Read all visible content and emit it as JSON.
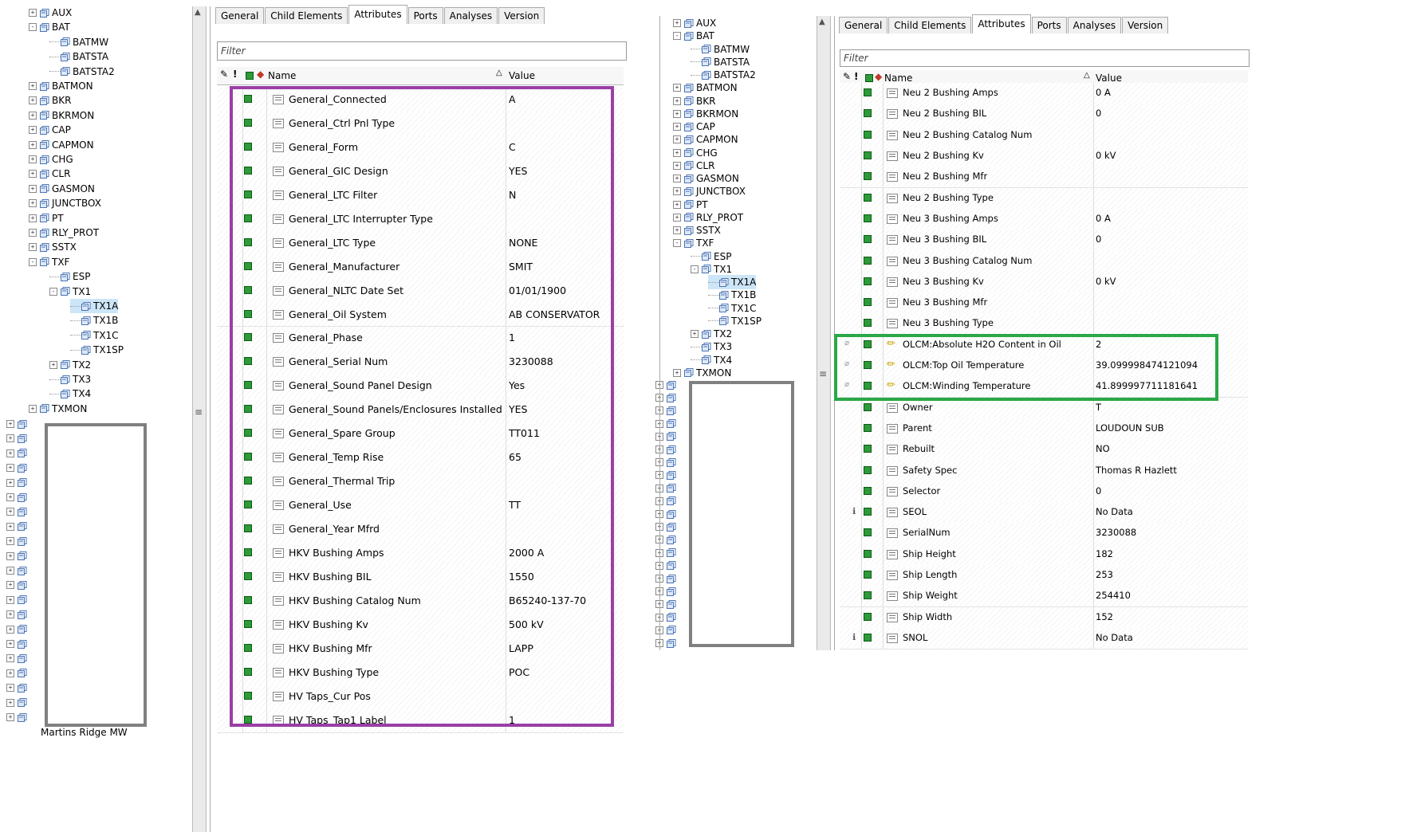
{
  "left": {
    "tree": [
      {
        "label": "AUX",
        "level": 1,
        "toggle": "+",
        "hasIcon": true
      },
      {
        "label": "BAT",
        "level": 1,
        "toggle": "-",
        "hasIcon": true
      },
      {
        "label": "BATMW",
        "level": 2,
        "toggle": "",
        "hasIcon": true
      },
      {
        "label": "BATSTA",
        "level": 2,
        "toggle": "",
        "hasIcon": true
      },
      {
        "label": "BATSTA2",
        "level": 2,
        "toggle": "",
        "hasIcon": true
      },
      {
        "label": "BATMON",
        "level": 1,
        "toggle": "+",
        "hasIcon": true
      },
      {
        "label": "BKR",
        "level": 1,
        "toggle": "+",
        "hasIcon": true
      },
      {
        "label": "BKRMON",
        "level": 1,
        "toggle": "+",
        "hasIcon": true
      },
      {
        "label": "CAP",
        "level": 1,
        "toggle": "+",
        "hasIcon": true
      },
      {
        "label": "CAPMON",
        "level": 1,
        "toggle": "+",
        "hasIcon": true
      },
      {
        "label": "CHG",
        "level": 1,
        "toggle": "+",
        "hasIcon": true
      },
      {
        "label": "CLR",
        "level": 1,
        "toggle": "+",
        "hasIcon": true
      },
      {
        "label": "GASMON",
        "level": 1,
        "toggle": "+",
        "hasIcon": true
      },
      {
        "label": "JUNCTBOX",
        "level": 1,
        "toggle": "+",
        "hasIcon": true
      },
      {
        "label": "PT",
        "level": 1,
        "toggle": "+",
        "hasIcon": true
      },
      {
        "label": "RLY_PROT",
        "level": 1,
        "toggle": "+",
        "hasIcon": true
      },
      {
        "label": "SSTX",
        "level": 1,
        "toggle": "+",
        "hasIcon": true
      },
      {
        "label": "TXF",
        "level": 1,
        "toggle": "-",
        "hasIcon": true
      },
      {
        "label": "ESP",
        "level": 2,
        "toggle": "",
        "hasIcon": true
      },
      {
        "label": "TX1",
        "level": 2,
        "toggle": "-",
        "hasIcon": true
      },
      {
        "label": "TX1A",
        "level": 3,
        "toggle": "",
        "hasIcon": true,
        "selected": true
      },
      {
        "label": "TX1B",
        "level": 3,
        "toggle": "",
        "hasIcon": true
      },
      {
        "label": "TX1C",
        "level": 3,
        "toggle": "",
        "hasIcon": true
      },
      {
        "label": "TX1SP",
        "level": 3,
        "toggle": "",
        "hasIcon": true
      },
      {
        "label": "TX2",
        "level": 2,
        "toggle": "+",
        "hasIcon": true
      },
      {
        "label": "TX3",
        "level": 2,
        "toggle": "",
        "hasIcon": true
      },
      {
        "label": "TX4",
        "level": 2,
        "toggle": "",
        "hasIcon": true
      },
      {
        "label": "TXMON",
        "level": 1,
        "toggle": "+",
        "hasIcon": true
      }
    ],
    "bottom_label": "Martins Ridge MW",
    "tabs": [
      "General",
      "Child Elements",
      "Attributes",
      "Ports",
      "Analyses",
      "Version"
    ],
    "active_tab": "Attributes",
    "filter_placeholder": "Filter",
    "col_name": "Name",
    "col_value": "Value",
    "rows": [
      {
        "name": "General_Connected",
        "value": "A"
      },
      {
        "name": "General_Ctrl Pnl Type",
        "value": ""
      },
      {
        "name": "General_Form",
        "value": "C"
      },
      {
        "name": "General_GIC Design",
        "value": "YES"
      },
      {
        "name": "General_LTC Filter",
        "value": "N"
      },
      {
        "name": "General_LTC Interrupter Type",
        "value": ""
      },
      {
        "name": "General_LTC Type",
        "value": "NONE"
      },
      {
        "name": "General_Manufacturer",
        "value": "SMIT"
      },
      {
        "name": "General_NLTC Date Set",
        "value": "01/01/1900"
      },
      {
        "name": "General_Oil System",
        "value": "AB CONSERVATOR"
      },
      {
        "name": "General_Phase",
        "value": "1"
      },
      {
        "name": "General_Serial Num",
        "value": "3230088"
      },
      {
        "name": "General_Sound Panel Design",
        "value": "Yes"
      },
      {
        "name": "General_Sound Panels/Enclosures Installed",
        "value": "YES"
      },
      {
        "name": "General_Spare Group",
        "value": "TT011"
      },
      {
        "name": "General_Temp Rise",
        "value": "65"
      },
      {
        "name": "General_Thermal Trip",
        "value": ""
      },
      {
        "name": "General_Use",
        "value": "TT"
      },
      {
        "name": "General_Year Mfrd",
        "value": ""
      },
      {
        "name": "HKV Bushing Amps",
        "value": "2000 A"
      },
      {
        "name": "HKV Bushing BIL",
        "value": "1550"
      },
      {
        "name": "HKV Bushing Catalog Num",
        "value": "B65240-137-70"
      },
      {
        "name": "HKV Bushing Kv",
        "value": "500 kV"
      },
      {
        "name": "HKV Bushing Mfr",
        "value": "LAPP"
      },
      {
        "name": "HKV Bushing Type",
        "value": "POC"
      },
      {
        "name": "HV Taps_Cur Pos",
        "value": ""
      },
      {
        "name": "HV Taps_Tap1 Label",
        "value": "1"
      }
    ]
  },
  "right": {
    "tree": [
      {
        "label": "AUX",
        "level": 1,
        "toggle": "+"
      },
      {
        "label": "BAT",
        "level": 1,
        "toggle": "-"
      },
      {
        "label": "BATMW",
        "level": 2,
        "toggle": ""
      },
      {
        "label": "BATSTA",
        "level": 2,
        "toggle": ""
      },
      {
        "label": "BATSTA2",
        "level": 2,
        "toggle": ""
      },
      {
        "label": "BATMON",
        "level": 1,
        "toggle": "+"
      },
      {
        "label": "BKR",
        "level": 1,
        "toggle": "+"
      },
      {
        "label": "BKRMON",
        "level": 1,
        "toggle": "+"
      },
      {
        "label": "CAP",
        "level": 1,
        "toggle": "+"
      },
      {
        "label": "CAPMON",
        "level": 1,
        "toggle": "+"
      },
      {
        "label": "CHG",
        "level": 1,
        "toggle": "+"
      },
      {
        "label": "CLR",
        "level": 1,
        "toggle": "+"
      },
      {
        "label": "GASMON",
        "level": 1,
        "toggle": "+"
      },
      {
        "label": "JUNCTBOX",
        "level": 1,
        "toggle": "+"
      },
      {
        "label": "PT",
        "level": 1,
        "toggle": "+"
      },
      {
        "label": "RLY_PROT",
        "level": 1,
        "toggle": "+"
      },
      {
        "label": "SSTX",
        "level": 1,
        "toggle": "+"
      },
      {
        "label": "TXF",
        "level": 1,
        "toggle": "-"
      },
      {
        "label": "ESP",
        "level": 2,
        "toggle": ""
      },
      {
        "label": "TX1",
        "level": 2,
        "toggle": "-"
      },
      {
        "label": "TX1A",
        "level": 3,
        "toggle": "",
        "selected": true
      },
      {
        "label": "TX1B",
        "level": 3,
        "toggle": ""
      },
      {
        "label": "TX1C",
        "level": 3,
        "toggle": ""
      },
      {
        "label": "TX1SP",
        "level": 3,
        "toggle": ""
      },
      {
        "label": "TX2",
        "level": 2,
        "toggle": "+"
      },
      {
        "label": "TX3",
        "level": 2,
        "toggle": ""
      },
      {
        "label": "TX4",
        "level": 2,
        "toggle": ""
      },
      {
        "label": "TXMON",
        "level": 1,
        "toggle": "+"
      }
    ],
    "tabs": [
      "General",
      "Child Elements",
      "Attributes",
      "Ports",
      "Analyses",
      "Version"
    ],
    "active_tab": "Attributes",
    "filter_placeholder": "Filter",
    "col_name": "Name",
    "col_value": "Value",
    "rows": [
      {
        "name": "Neu 2 Bushing Amps",
        "value": "0 A",
        "icon": "list"
      },
      {
        "name": "Neu 2 Bushing BIL",
        "value": "0",
        "icon": "list"
      },
      {
        "name": "Neu 2 Bushing Catalog Num",
        "value": "",
        "icon": "list"
      },
      {
        "name": "Neu 2 Bushing Kv",
        "value": "0 kV",
        "icon": "list"
      },
      {
        "name": "Neu 2 Bushing Mfr",
        "value": "",
        "icon": "list"
      },
      {
        "name": "Neu 2 Bushing Type",
        "value": "",
        "icon": "list"
      },
      {
        "name": "Neu 3 Bushing Amps",
        "value": "0 A",
        "icon": "list"
      },
      {
        "name": "Neu 3 Bushing BIL",
        "value": "0",
        "icon": "list"
      },
      {
        "name": "Neu 3 Bushing Catalog Num",
        "value": "",
        "icon": "list"
      },
      {
        "name": "Neu 3 Bushing Kv",
        "value": "0 kV",
        "icon": "list"
      },
      {
        "name": "Neu 3 Bushing Mfr",
        "value": "",
        "icon": "list"
      },
      {
        "name": "Neu 3 Bushing Type",
        "value": "",
        "icon": "list"
      },
      {
        "name": "OLCM:Absolute H2O Content in Oil",
        "value": "2",
        "icon": "pencil"
      },
      {
        "name": "OLCM:Top Oil Temperature",
        "value": "39.099998474121094",
        "icon": "pencil"
      },
      {
        "name": "OLCM:Winding Temperature",
        "value": "41.899997711181641",
        "icon": "pencil"
      },
      {
        "name": "Owner",
        "value": "T",
        "icon": "list"
      },
      {
        "name": "Parent",
        "value": "LOUDOUN SUB",
        "icon": "list"
      },
      {
        "name": "Rebuilt",
        "value": "NO",
        "icon": "list"
      },
      {
        "name": "Safety Spec",
        "value": "Thomas R Hazlett",
        "icon": "list"
      },
      {
        "name": "Selector",
        "value": "0",
        "icon": "list"
      },
      {
        "name": "SEOL",
        "value": "No Data",
        "icon": "list",
        "info": true
      },
      {
        "name": "SerialNum",
        "value": "3230088",
        "icon": "list"
      },
      {
        "name": "Ship Height",
        "value": "182",
        "icon": "list"
      },
      {
        "name": "Ship Length",
        "value": "253",
        "icon": "list"
      },
      {
        "name": "Ship Weight",
        "value": "254410",
        "icon": "list"
      },
      {
        "name": "Ship Width",
        "value": "152",
        "icon": "list"
      },
      {
        "name": "SNOL",
        "value": "No Data",
        "icon": "list",
        "info": true
      }
    ]
  },
  "colors": {
    "highlight_purple": "#9b3fa6",
    "highlight_green": "#2aa845",
    "redacted_box": "#808080",
    "selected_bg": "#cde6f7"
  }
}
